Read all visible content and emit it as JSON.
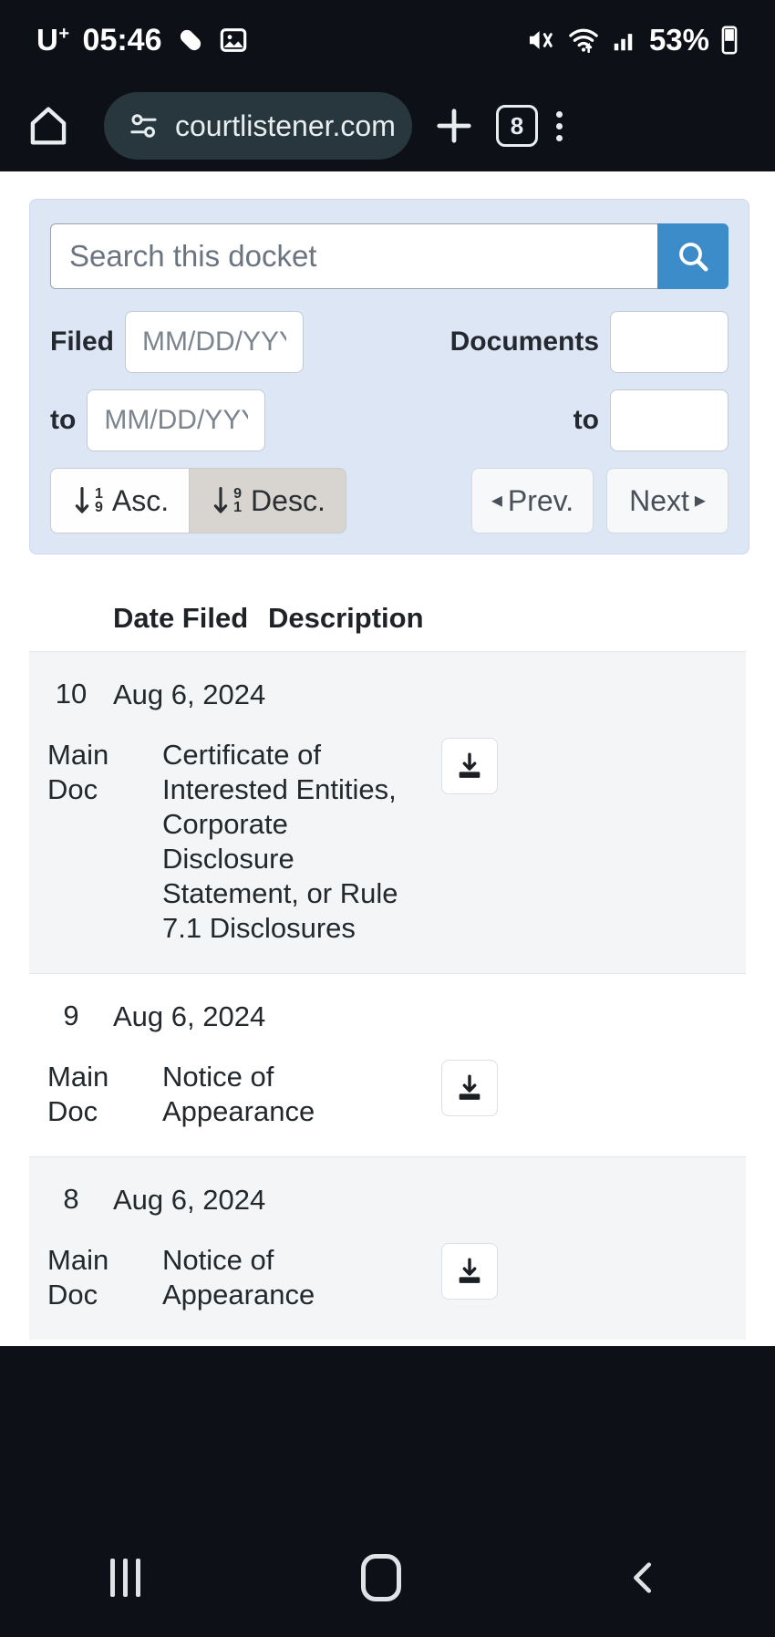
{
  "status_bar": {
    "carrier": "U",
    "carrier_sup": "+",
    "time": "05:46",
    "battery_percent": "53%",
    "icons": [
      "pill-icon",
      "image-icon",
      "mute-icon",
      "wifi-icon",
      "signal-icon",
      "battery-icon"
    ]
  },
  "browser": {
    "home_icon": "home-icon",
    "site_settings_icon": "site-settings-icon",
    "url": "courtlistener.com",
    "new_tab_label": "+",
    "tab_count": "8",
    "menu_icon": "kebab-menu-icon"
  },
  "search_panel": {
    "search_placeholder": "Search this docket",
    "search_value": "",
    "search_button_icon": "search-icon",
    "filed_label": "Filed",
    "filed_from_placeholder": "MM/DD/YYYY",
    "filed_from_value": "",
    "filed_to_label": "to",
    "filed_to_placeholder": "MM/DD/YYYY",
    "filed_to_value": "",
    "documents_label": "Documents",
    "documents_from_value": "",
    "documents_to_label": "to",
    "documents_to_value": "",
    "sort_asc_label": "Asc.",
    "sort_asc_sup": "1",
    "sort_asc_sub": "9",
    "sort_desc_label": "Desc.",
    "sort_desc_sup": "9",
    "sort_desc_sub": "1",
    "active_sort": "desc",
    "prev_label": "Prev.",
    "prev_arrow": "◂",
    "next_label": "Next",
    "next_arrow": "▸",
    "accent_color": "#3d8cca",
    "panel_bg": "#dde6f5"
  },
  "table": {
    "headers": {
      "date_filed": "Date Filed",
      "description": "Description"
    },
    "rows": [
      {
        "number": "10",
        "date": "Aug 6, 2024",
        "kind": "Main Doc",
        "description": "Certificate of Interested Entities, Corporate Disclosure Statement, or Rule 7.1 Disclosures",
        "download_icon": "download-icon"
      },
      {
        "number": "9",
        "date": "Aug 6, 2024",
        "kind": "Main Doc",
        "description": "Notice of Appearance",
        "download_icon": "download-icon"
      },
      {
        "number": "8",
        "date": "Aug 6, 2024",
        "kind": "Main Doc",
        "description": "Notice of Appearance",
        "download_icon": "download-icon"
      }
    ]
  },
  "nav_bar": {
    "recents_icon": "recents-icon",
    "home_icon": "home-nav-icon",
    "back_icon": "back-icon"
  }
}
